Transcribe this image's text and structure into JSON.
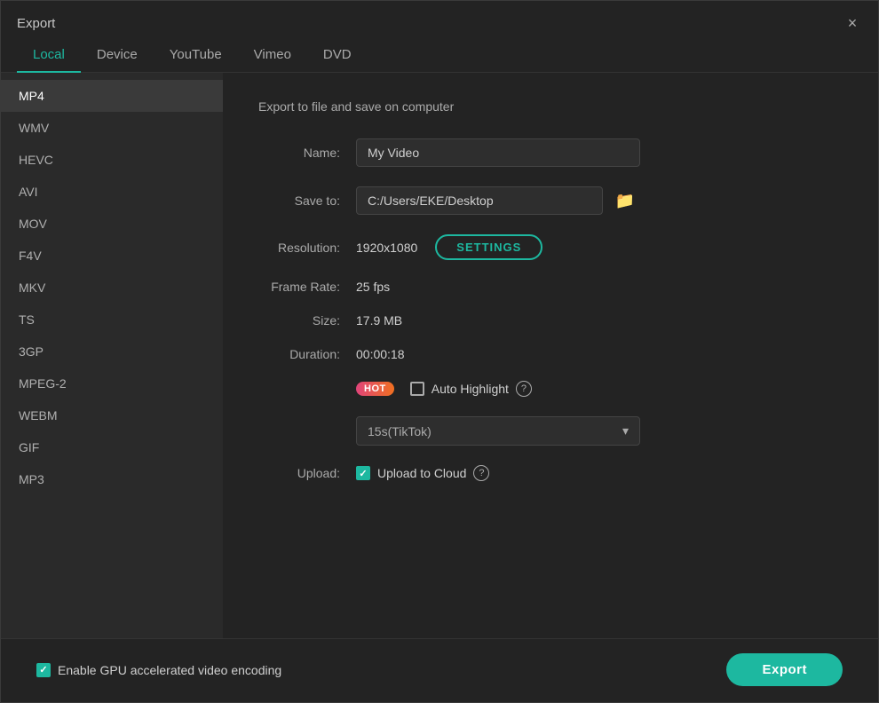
{
  "dialog": {
    "title": "Export",
    "close_label": "×"
  },
  "tabs": [
    {
      "id": "local",
      "label": "Local",
      "active": true
    },
    {
      "id": "device",
      "label": "Device",
      "active": false
    },
    {
      "id": "youtube",
      "label": "YouTube",
      "active": false
    },
    {
      "id": "vimeo",
      "label": "Vimeo",
      "active": false
    },
    {
      "id": "dvd",
      "label": "DVD",
      "active": false
    }
  ],
  "sidebar": {
    "items": [
      {
        "id": "mp4",
        "label": "MP4",
        "active": true
      },
      {
        "id": "wmv",
        "label": "WMV",
        "active": false
      },
      {
        "id": "hevc",
        "label": "HEVC",
        "active": false
      },
      {
        "id": "avi",
        "label": "AVI",
        "active": false
      },
      {
        "id": "mov",
        "label": "MOV",
        "active": false
      },
      {
        "id": "f4v",
        "label": "F4V",
        "active": false
      },
      {
        "id": "mkv",
        "label": "MKV",
        "active": false
      },
      {
        "id": "ts",
        "label": "TS",
        "active": false
      },
      {
        "id": "3gp",
        "label": "3GP",
        "active": false
      },
      {
        "id": "mpeg2",
        "label": "MPEG-2",
        "active": false
      },
      {
        "id": "webm",
        "label": "WEBM",
        "active": false
      },
      {
        "id": "gif",
        "label": "GIF",
        "active": false
      },
      {
        "id": "mp3",
        "label": "MP3",
        "active": false
      }
    ]
  },
  "main": {
    "section_title": "Export to file and save on computer",
    "name_label": "Name:",
    "name_value": "My Video",
    "name_placeholder": "My Video",
    "save_to_label": "Save to:",
    "save_to_value": "C:/Users/EKE/Desktop",
    "resolution_label": "Resolution:",
    "resolution_value": "1920x1080",
    "settings_btn_label": "SETTINGS",
    "frame_rate_label": "Frame Rate:",
    "frame_rate_value": "25 fps",
    "size_label": "Size:",
    "size_value": "17.9 MB",
    "duration_label": "Duration:",
    "duration_value": "00:00:18",
    "hot_badge": "HOT",
    "auto_highlight_label": "Auto Highlight",
    "tiktok_option": "15s(TikTok)",
    "upload_label": "Upload:",
    "upload_to_cloud_label": "Upload to Cloud",
    "upload_checked": true,
    "auto_highlight_checked": false
  },
  "bottom": {
    "gpu_label": "Enable GPU accelerated video encoding",
    "gpu_checked": true,
    "export_label": "Export"
  },
  "icons": {
    "folder": "🗁",
    "chevron_down": "▾",
    "close": "✕",
    "question": "?"
  }
}
